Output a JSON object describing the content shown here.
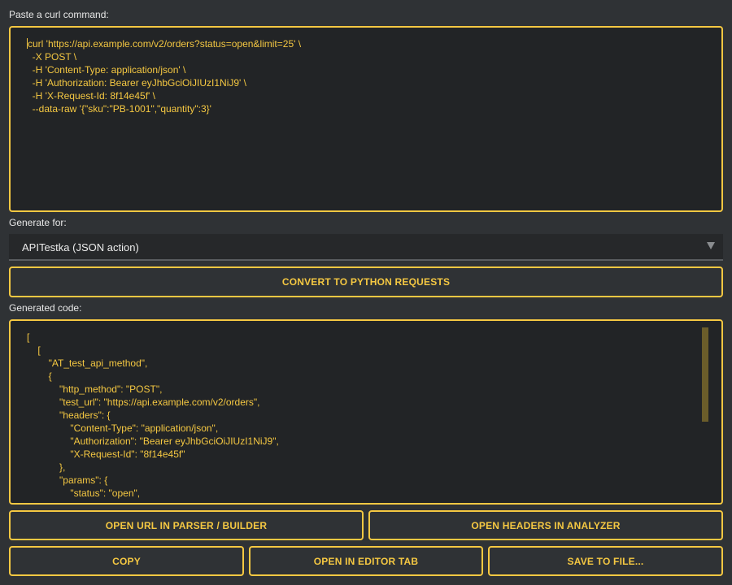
{
  "curl_section": {
    "label": "Paste a curl command:",
    "lines": [
      "curl 'https://api.example.com/v2/orders?status=open&limit=25' \\",
      "  -X POST \\",
      "  -H 'Content-Type: application/json' \\",
      "  -H 'Authorization: Bearer eyJhbGciOiJIUzI1NiJ9' \\",
      "  -H 'X-Request-Id: 8f14e45f' \\",
      "  --data-raw '{\"sku\":\"PB-1001\",\"quantity\":3}'"
    ]
  },
  "generate_for": {
    "label": "Generate for:",
    "selected": "APITestka (JSON action)",
    "icon": "chevron-down-icon"
  },
  "convert_button": {
    "label": "CONVERT TO PYTHON REQUESTS"
  },
  "output_section": {
    "label": "Generated code:",
    "lines": [
      "[",
      "    [",
      "        \"AT_test_api_method\",",
      "        {",
      "            \"http_method\": \"POST\",",
      "            \"test_url\": \"https://api.example.com/v2/orders\",",
      "            \"headers\": {",
      "                \"Content-Type\": \"application/json\",",
      "                \"Authorization\": \"Bearer eyJhbGciOiJIUzI1NiJ9\",",
      "                \"X-Request-Id\": \"8f14e45f\"",
      "            },",
      "            \"params\": {",
      "                \"status\": \"open\","
    ]
  },
  "actions": {
    "open_url": "OPEN URL IN PARSER / BUILDER",
    "open_headers": "OPEN HEADERS IN ANALYZER",
    "copy": "COPY",
    "open_editor": "OPEN IN EDITOR TAB",
    "save_file": "SAVE TO FILE..."
  },
  "colors": {
    "accent": "#f5c842",
    "background": "#2f3235",
    "field": "#222426"
  }
}
